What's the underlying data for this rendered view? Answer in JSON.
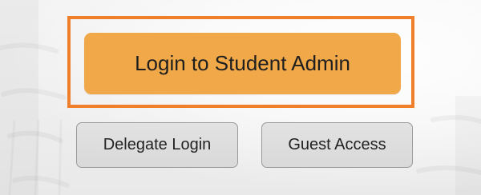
{
  "login": {
    "primary_label": "Login to Student Admin",
    "delegate_label": "Delegate Login",
    "guest_label": "Guest Access"
  },
  "colors": {
    "highlight_border": "#f07f2b",
    "primary_button_bg": "#f0a848",
    "secondary_button_bg": "#dcdcdc",
    "secondary_button_border": "#9a9a9a"
  }
}
